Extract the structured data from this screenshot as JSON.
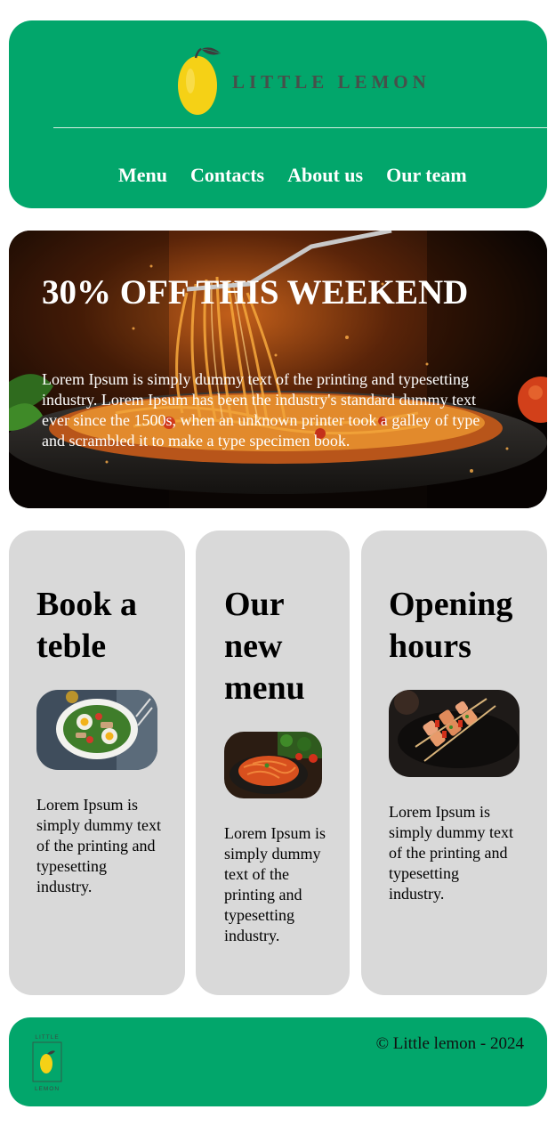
{
  "header": {
    "brand_name": "LITTLE LEMON",
    "nav": [
      {
        "label": "Menu"
      },
      {
        "label": "Contacts"
      },
      {
        "label": "About us"
      },
      {
        "label": "Our team"
      }
    ]
  },
  "hero": {
    "title": "30% OFF THIS WEEKEND",
    "text": "Lorem Ipsum is simply dummy text of the printing and typesetting industry. Lorem Ipsum has been the industry's standard dummy text ever since the 1500s, when an unknown printer took a galley of type and scrambled it to make a type specimen book."
  },
  "cards": [
    {
      "title": "Book a teble",
      "text": "Lorem Ipsum is simply dummy text of the printing and typesetting industry."
    },
    {
      "title": "Our new menu",
      "text": "Lorem Ipsum is simply dummy text of the printing and typesetting industry."
    },
    {
      "title": "Opening hours",
      "text": "Lorem Ipsum is simply dummy text of the printing and typesetting industry."
    }
  ],
  "footer": {
    "copyright": "© Little lemon - 2024",
    "logo_text": "LITTLE LEMON"
  },
  "colors": {
    "brand_green": "#02a66b",
    "lemon_yellow": "#f5d116",
    "card_gray": "#d9d9d9",
    "brand_text_gray": "#474f4a"
  }
}
